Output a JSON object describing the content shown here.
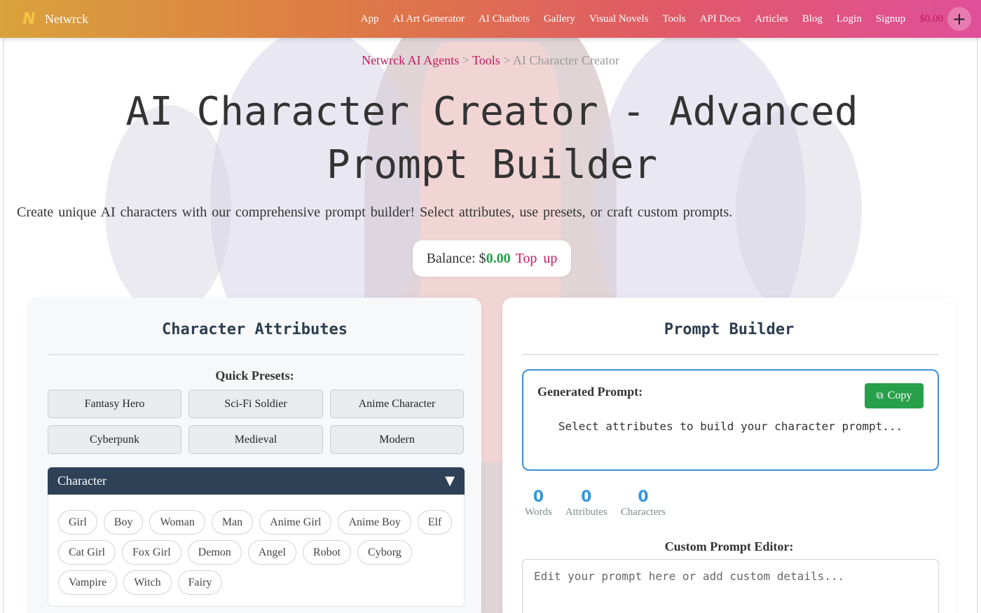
{
  "navbar": {
    "brand_logo": "N",
    "brand_name": "Netwrck",
    "links": [
      "App",
      "AI Art Generator",
      "AI Chatbots",
      "Gallery",
      "Visual Novels",
      "Tools",
      "API Docs",
      "Articles",
      "Blog",
      "Login",
      "Signup"
    ],
    "balance": "$0.00",
    "plus_label": "+"
  },
  "breadcrumb": {
    "home": "Netwrck AI Agents",
    "sep1": " > ",
    "tools": "Tools",
    "sep2": " > ",
    "current": "AI Character Creator"
  },
  "page": {
    "title": "AI Character Creator - Advanced Prompt Builder",
    "intro": "Create unique AI characters with our comprehensive prompt builder! Select attributes, use presets, or craft custom prompts."
  },
  "balance_pill": {
    "label": "Balance: $",
    "amount": "0.00",
    "topup": "Top up"
  },
  "attributes_panel": {
    "title": "Character Attributes",
    "presets_label": "Quick Presets:",
    "presets": [
      "Fantasy Hero",
      "Sci-Fi Soldier",
      "Anime Character",
      "Cyberpunk",
      "Medieval",
      "Modern"
    ],
    "category": {
      "name": "Character",
      "caret": "▼",
      "chips": [
        "Girl",
        "Boy",
        "Woman",
        "Man",
        "Anime Girl",
        "Anime Boy",
        "Elf",
        "Cat Girl",
        "Fox Girl",
        "Demon",
        "Angel",
        "Robot",
        "Cyborg",
        "Vampire",
        "Witch",
        "Fairy"
      ]
    }
  },
  "builder_panel": {
    "title": "Prompt Builder",
    "generated_label": "Generated Prompt:",
    "copy_label": "Copy",
    "copy_icon": "⧉",
    "placeholder": "Select attributes to build your character prompt...",
    "stats": [
      {
        "value": "0",
        "label": "Words"
      },
      {
        "value": "0",
        "label": "Attributes"
      },
      {
        "value": "0",
        "label": "Characters"
      }
    ],
    "editor_label": "Custom Prompt Editor:",
    "editor_placeholder": "Edit your prompt here or add custom details..."
  },
  "colors": {
    "accent": "#c2185b",
    "balance_green": "#22a04b",
    "copy_green": "#27a04a",
    "prompt_border": "#3d8fd6",
    "category_header": "#2f4157",
    "stat_blue": "#3498db"
  }
}
